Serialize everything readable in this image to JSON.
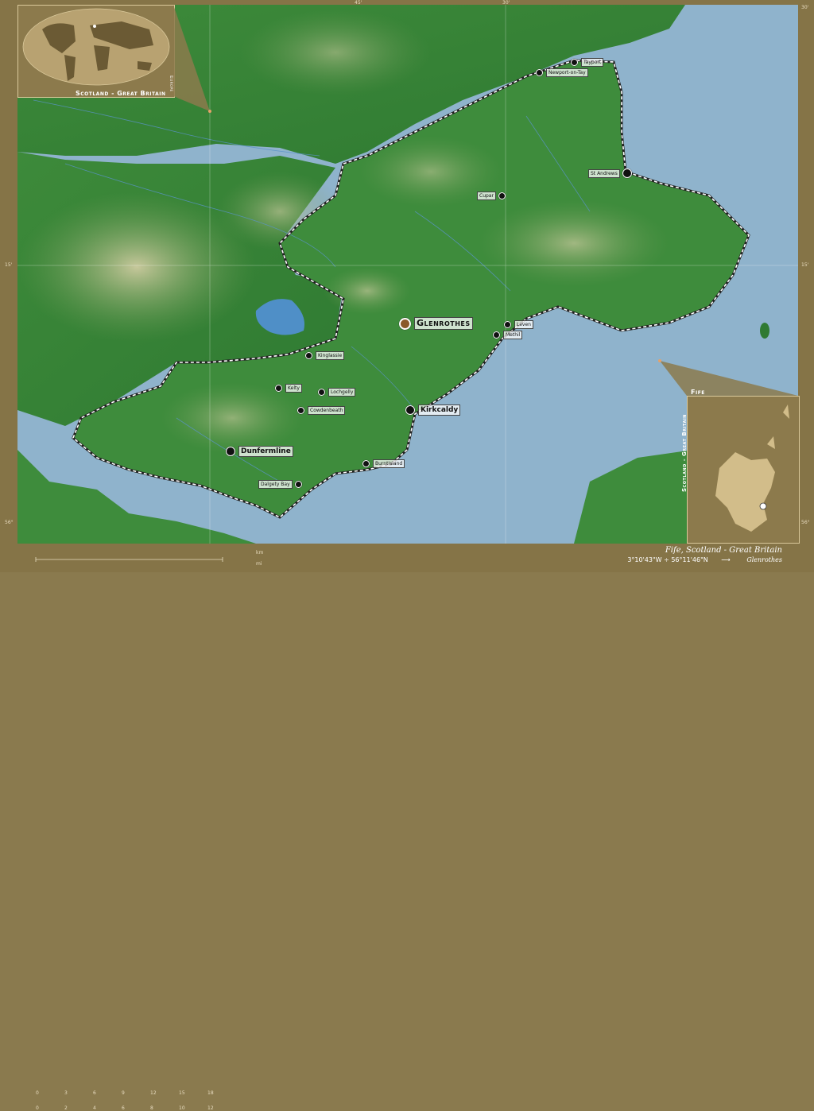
{
  "map": {
    "region_name": "Fife",
    "caption": "Fife, Scotland - Great Britain",
    "coords_text": "3°10'43\"W ÷ 56°11'46\"N",
    "arrow": "⟶",
    "destination": "Glenrothes",
    "ticks": {
      "lat_top": "30'",
      "lat_mid": "15'",
      "lat_bottom": "56°",
      "lon_top_1": "30'",
      "lon_top_2": "15'",
      "lon_top_3": "3°",
      "lon_top_4": "45'",
      "lon_top_5": "30'"
    },
    "cities": [
      {
        "name": "Glenrothes",
        "kind": "capital"
      },
      {
        "name": "Kirkcaldy",
        "kind": "large"
      },
      {
        "name": "Dunfermline",
        "kind": "large"
      },
      {
        "name": "St Andrews",
        "kind": "small"
      },
      {
        "name": "Cupar",
        "kind": "small"
      },
      {
        "name": "Tayport",
        "kind": "small"
      },
      {
        "name": "Newport-on-Tay",
        "kind": "small"
      },
      {
        "name": "Leven",
        "kind": "small"
      },
      {
        "name": "Methil",
        "kind": "small"
      },
      {
        "name": "Lochgelly",
        "kind": "small"
      },
      {
        "name": "Cowdenbeath",
        "kind": "small"
      },
      {
        "name": "Kelty",
        "kind": "small"
      },
      {
        "name": "Dalgety Bay",
        "kind": "small"
      },
      {
        "name": "Kinglassie",
        "kind": "small"
      },
      {
        "name": "Burntisland",
        "kind": "small"
      }
    ]
  },
  "insets": {
    "world_title": "Scotland - Great Britain",
    "world_sub": "Europe",
    "scot_title": "Fife",
    "scot_side": "Scotland - Great Britain"
  },
  "scale": {
    "km_unit": "km",
    "mi_unit": "mi",
    "km_ticks": [
      "0",
      "3",
      "6",
      "9",
      "12",
      "15",
      "18"
    ],
    "mi_ticks": [
      "0",
      "2",
      "4",
      "6",
      "8",
      "10",
      "12"
    ]
  },
  "colors": {
    "sea": "#8fb3cc",
    "land_green": "#3f8a3a",
    "land_highland": "#b5b98a",
    "frame": "#857447",
    "border_line": "#ffffff"
  }
}
